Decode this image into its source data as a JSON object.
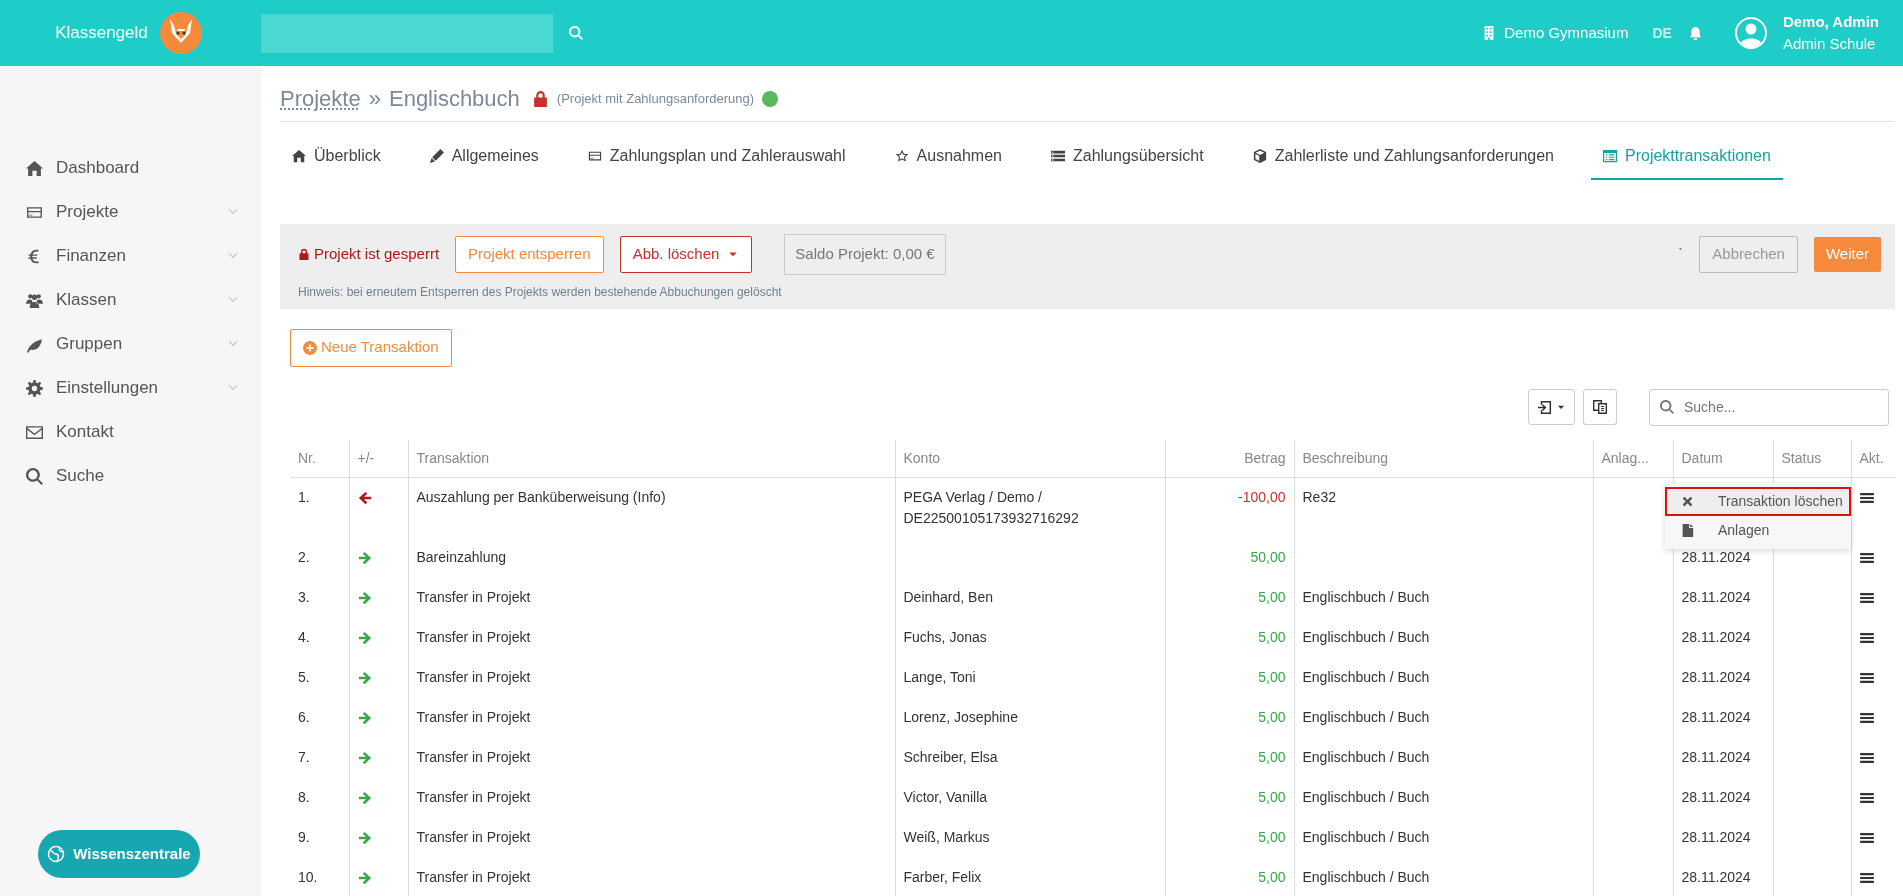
{
  "header": {
    "brand": "Klassengeld",
    "school": "Demo Gymnasium",
    "language": {
      "label": "DE",
      "selected": true
    },
    "user_name": "Demo, Admin",
    "user_role": "Admin Schule"
  },
  "sidebar": {
    "items": [
      {
        "label": "Dashboard",
        "expandable": false
      },
      {
        "label": "Projekte",
        "expandable": true
      },
      {
        "label": "Finanzen",
        "expandable": true
      },
      {
        "label": "Klassen",
        "expandable": true
      },
      {
        "label": "Gruppen",
        "expandable": true
      },
      {
        "label": "Einstellungen",
        "expandable": true
      },
      {
        "label": "Kontakt",
        "expandable": false
      },
      {
        "label": "Suche",
        "expandable": false
      }
    ],
    "help_button": "Wissenszentrale"
  },
  "breadcrumb": {
    "parent": "Projekte",
    "separator": "»",
    "current": "Englischbuch",
    "locked": true,
    "note": "(Projekt mit Zahlungsanforderung)"
  },
  "tabs": [
    {
      "label": "Überblick",
      "selected": false
    },
    {
      "label": "Allgemeines",
      "selected": false
    },
    {
      "label": "Zahlungsplan und Zahlerauswahl",
      "selected": false
    },
    {
      "label": "Ausnahmen",
      "selected": false
    },
    {
      "label": "Zahlungsübersicht",
      "selected": false
    },
    {
      "label": "Zahlerliste und Zahlungsanforderungen",
      "selected": false
    },
    {
      "label": "Projekttransaktionen",
      "selected": true
    }
  ],
  "lock_bar": {
    "status": "Projekt ist gesperrt",
    "unlock_button": "Projekt entsperren",
    "delete_button": "Abb. löschen",
    "balance": "Saldo Projekt: 0,00 €",
    "hint": "Hinweis: bei erneutem Entsperren des Projekts werden bestehende Abbuchungen gelöscht",
    "stray_mark": "`",
    "cancel_button": "Abbrechen",
    "cancel_disabled": true,
    "next_button": "Weiter"
  },
  "new_button": "Neue Transaktion",
  "table": {
    "search_placeholder": "Suche...",
    "columns": [
      "Nr.",
      "+/-",
      "Transaktion",
      "Konto",
      "Betrag",
      "Beschreibung",
      "Anlag...",
      "Datum",
      "Status",
      "Akt."
    ],
    "rows": [
      {
        "nr": "1.",
        "kind": "out",
        "transaktion": "Auszahlung per Banküberweisung (Info)",
        "konto": "PEGA Verlag / Demo / DE22500105173932716292",
        "betrag": "-100,00",
        "beschreibung": "Re32"
      },
      {
        "nr": "2.",
        "kind": "in",
        "transaktion": "Bareinzahlung",
        "betrag": "50,00",
        "datum": "28.11.2024"
      },
      {
        "nr": "3.",
        "kind": "in",
        "transaktion": "Transfer in Projekt",
        "konto": "Deinhard, Ben",
        "betrag": "5,00",
        "beschreibung": "Englischbuch / Buch",
        "datum": "28.11.2024"
      },
      {
        "nr": "4.",
        "kind": "in",
        "transaktion": "Transfer in Projekt",
        "konto": "Fuchs, Jonas",
        "betrag": "5,00",
        "beschreibung": "Englischbuch / Buch",
        "datum": "28.11.2024"
      },
      {
        "nr": "5.",
        "kind": "in",
        "transaktion": "Transfer in Projekt",
        "konto": "Lange, Toni",
        "betrag": "5,00",
        "beschreibung": "Englischbuch / Buch",
        "datum": "28.11.2024"
      },
      {
        "nr": "6.",
        "kind": "in",
        "transaktion": "Transfer in Projekt",
        "konto": "Lorenz, Josephine",
        "betrag": "5,00",
        "beschreibung": "Englischbuch / Buch",
        "datum": "28.11.2024"
      },
      {
        "nr": "7.",
        "kind": "in",
        "transaktion": "Transfer in Projekt",
        "konto": "Schreiber, Elsa",
        "betrag": "5,00",
        "beschreibung": "Englischbuch / Buch",
        "datum": "28.11.2024"
      },
      {
        "nr": "8.",
        "kind": "in",
        "transaktion": "Transfer in Projekt",
        "konto": "Victor, Vanilla",
        "betrag": "5,00",
        "beschreibung": "Englischbuch / Buch",
        "datum": "28.11.2024"
      },
      {
        "nr": "9.",
        "kind": "in",
        "transaktion": "Transfer in Projekt",
        "konto": "Weiß, Markus",
        "betrag": "5,00",
        "beschreibung": "Englischbuch / Buch",
        "datum": "28.11.2024"
      },
      {
        "nr": "10.",
        "kind": "in",
        "transaktion": "Transfer in Projekt",
        "konto": "Farber, Felix",
        "betrag": "5,00",
        "beschreibung": "Englischbuch / Buch",
        "datum": "28.11.2024"
      }
    ]
  },
  "row_menu": {
    "items": [
      {
        "label": "Transaktion löschen",
        "selected": true
      },
      {
        "label": "Anlagen",
        "selected": false
      }
    ]
  }
}
